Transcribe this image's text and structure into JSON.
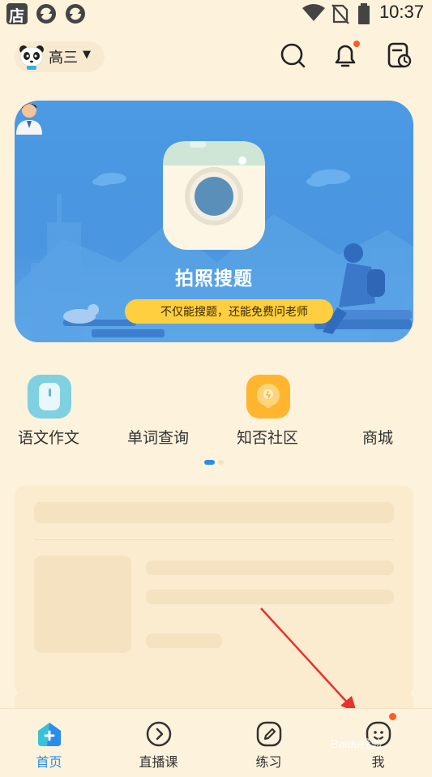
{
  "status_bar": {
    "store_label": "店",
    "time": "10:37",
    "icons": [
      "store-icon",
      "sync-icon",
      "sync-icon",
      "wifi-icon",
      "no-sim-icon",
      "battery-icon"
    ]
  },
  "header": {
    "grade": "高三",
    "caret": "▼",
    "icons": [
      "search-icon",
      "bell-icon",
      "schedule-icon"
    ]
  },
  "banner": {
    "title": "拍照搜题",
    "tagline": "不仅能搜题，还能免费问老师"
  },
  "quick_actions": [
    {
      "label": "语文作文",
      "icon": "essay-icon"
    },
    {
      "label": "单词查询",
      "icon": "dictionary-icon"
    },
    {
      "label": "知否社区",
      "icon": "lightbulb-icon"
    },
    {
      "label": "商城",
      "icon": "shop-icon"
    }
  ],
  "pager": {
    "pages": 2,
    "active": 1
  },
  "tabs": [
    {
      "label": "首页",
      "icon": "home-icon",
      "active": true
    },
    {
      "label": "直播课",
      "icon": "play-icon",
      "active": false
    },
    {
      "label": "练习",
      "icon": "pen-icon",
      "active": false
    },
    {
      "label": "我",
      "icon": "profile-icon",
      "active": false
    }
  ],
  "watermark": "Baidu经验",
  "colors": {
    "accent": "#2a8de8",
    "background": "#fdf2dc",
    "banner": "#4a95df",
    "badge": "#ff5a2a"
  }
}
